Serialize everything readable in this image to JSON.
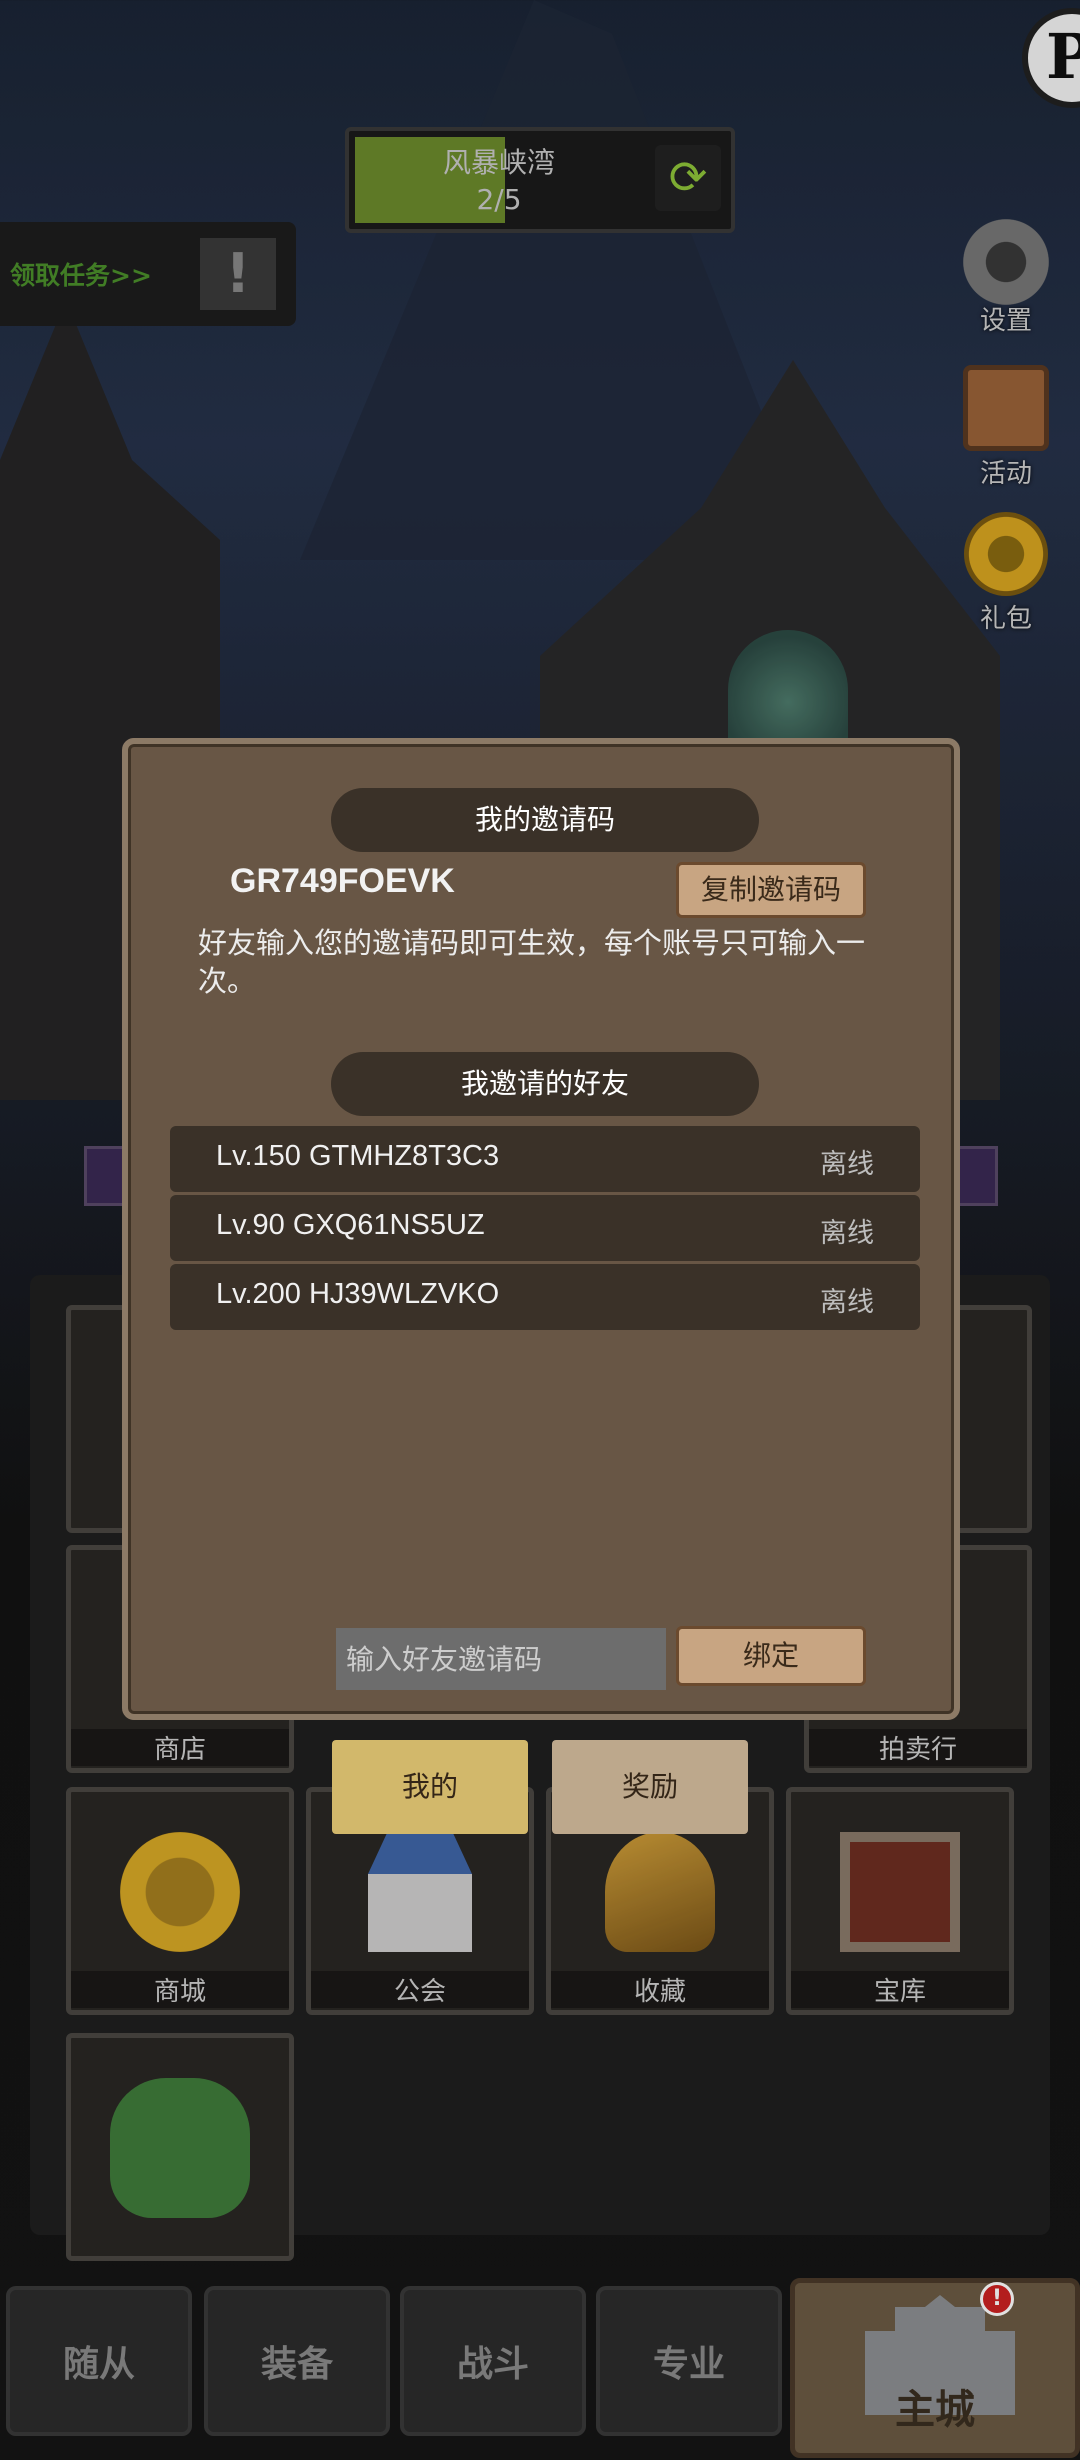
{
  "top": {
    "logo_letter": "P",
    "location_name": "风暴峡湾",
    "location_progress": "2/5",
    "quest_label": "领取任务>>"
  },
  "side_menu": [
    {
      "label": "设置",
      "icon": "gear-icon"
    },
    {
      "label": "活动",
      "icon": "board-icon"
    },
    {
      "label": "礼包",
      "icon": "coin-icon"
    }
  ],
  "tiles": {
    "shop": "商店",
    "auction": "拍卖行",
    "mall": "商城",
    "guild": "公会",
    "collection": "收藏",
    "vault": "宝库"
  },
  "tabs": {
    "mine": "我的",
    "reward": "奖励"
  },
  "bottom_nav": {
    "followers": "随从",
    "equipment": "装备",
    "battle": "战斗",
    "profession": "专业",
    "main_city": "主城",
    "badge": "!"
  },
  "modal": {
    "my_code_header": "我的邀请码",
    "invite_code": "GR749FOEVK",
    "copy_button": "复制邀请码",
    "note": "好友输入您的邀请码即可生效，每个账号只可输入一次。",
    "friends_header": "我邀请的好友",
    "friends": [
      {
        "name": "Lv.150 GTMHZ8T3C3",
        "status": "离线"
      },
      {
        "name": "Lv.90 GXQ61NS5UZ",
        "status": "离线"
      },
      {
        "name": "Lv.200 HJ39WLZVKO",
        "status": "离线"
      }
    ],
    "bind_placeholder": "输入好友邀请码",
    "bind_button": "绑定"
  },
  "colors": {
    "modal_bg": "#685645",
    "header_bg": "#3a3128",
    "button_bg": "#c8a582",
    "progress_green": "#6b8a2c",
    "quest_green": "#4a8f2b"
  }
}
